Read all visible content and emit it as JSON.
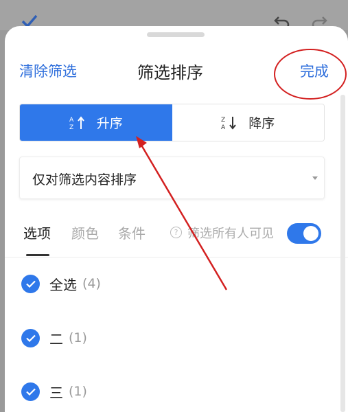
{
  "header": {
    "clear_label": "清除筛选",
    "title": "筛选排序",
    "done_label": "完成"
  },
  "sort": {
    "ascending_label": "升序",
    "descending_label": "降序",
    "selected": "ascending"
  },
  "sort_scope": {
    "selected": "仅对筛选内容排序"
  },
  "tabs": [
    {
      "label": "选项",
      "active": true
    },
    {
      "label": "颜色",
      "active": false
    },
    {
      "label": "条件",
      "active": false
    }
  ],
  "visibility": {
    "label": "筛选所有人可见",
    "enabled": true
  },
  "items": [
    {
      "label": "全选",
      "count": "(4)",
      "checked": true
    },
    {
      "label": "二",
      "count": "(1)",
      "checked": true
    },
    {
      "label": "三",
      "count": "(1)",
      "checked": true
    }
  ],
  "colors": {
    "accent": "#2f78ea",
    "link": "#2f6fdc",
    "annotation": "#d32020"
  }
}
